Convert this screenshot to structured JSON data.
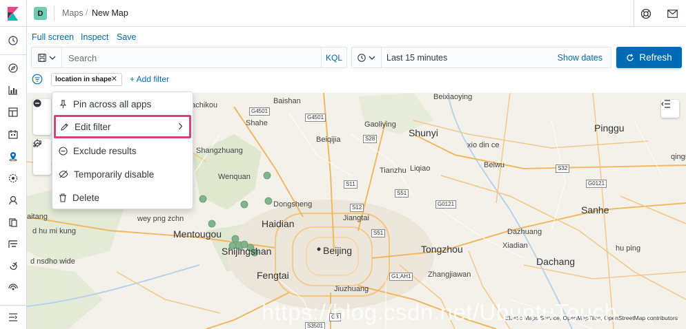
{
  "header": {
    "space_initial": "D",
    "breadcrumb_parent": "Maps",
    "breadcrumb_separator": "/",
    "breadcrumb_current": "New Map"
  },
  "app_menu": {
    "full_screen": "Full screen",
    "inspect": "Inspect",
    "save": "Save"
  },
  "query_bar": {
    "search_placeholder": "Search",
    "language": "KQL"
  },
  "time_picker": {
    "range": "Last 15 minutes",
    "show_dates": "Show dates",
    "refresh": "Refresh"
  },
  "filters": {
    "pill_label": "location in shape",
    "add_filter": "+ Add filter"
  },
  "filter_menu": {
    "items": [
      {
        "label": "Pin across all apps",
        "icon": "pin-icon"
      },
      {
        "label": "Edit filter",
        "icon": "pencil-icon"
      },
      {
        "label": "Exclude results",
        "icon": "minus-circle-icon"
      },
      {
        "label": "Temporarily disable",
        "icon": "eye-closed-icon"
      },
      {
        "label": "Delete",
        "icon": "trash-icon"
      }
    ]
  },
  "map": {
    "labels": {
      "machikou": "Machikou",
      "baishan": "Baishan",
      "beixiaoying": "Beixiaoying",
      "shahe": "Shahe",
      "gaoliying": "Gaoliying",
      "shunyi": "Shunyi",
      "pinggu": "Pinggu",
      "shangzhuang": "Shangzhuang",
      "beiqijia": "Beiqijia",
      "xio_din_ce": "xio din ce",
      "tianzhu": "Tianzhu",
      "liqiao": "Liqiao",
      "beiwu": "Beiwu",
      "qingshui": "qingshui",
      "wenquan": "Wenquan",
      "dongsheng": "Dongsheng",
      "haidian": "Haidian",
      "jiangtai": "Jiangtai",
      "sanhe": "Sanhe",
      "aitang": "aitang",
      "wey_png_zchn": "wey png zchn",
      "mentougou": "Mentougou",
      "dazhuang": "Dazhuang",
      "d_hu_mi_kung": "d hu mi kung",
      "shijingshan": "Shijingshan",
      "beijing": "Beijing",
      "tongzhou": "Tongzhou",
      "xiadian": "Xiadian",
      "hu_ping": "hu ping",
      "d_nsdho_wide": "d nsdho wide",
      "dachang": "Dachang",
      "fengtai": "Fengtai",
      "zhangjiawan": "Zhangjiawan",
      "jiuzhuang": "Jiuzhuang"
    },
    "shields": {
      "g4501_a": "G4501",
      "g4501_b": "G4501",
      "s28": "S28",
      "s32": "S32",
      "s11": "S11",
      "s51_a": "S51",
      "s12": "S12",
      "s51_b": "S51",
      "g0121": "G0121",
      "g0121_b": "G0121",
      "g1_ah1": "G1;AH1",
      "s3501": "S3501",
      "g3": "G3"
    },
    "attribution": "Elastic Maps Service, OpenMapTiles, OpenStreetMap contributors",
    "watermark": "https://blog.csdn.net/UbuntuTouch"
  }
}
